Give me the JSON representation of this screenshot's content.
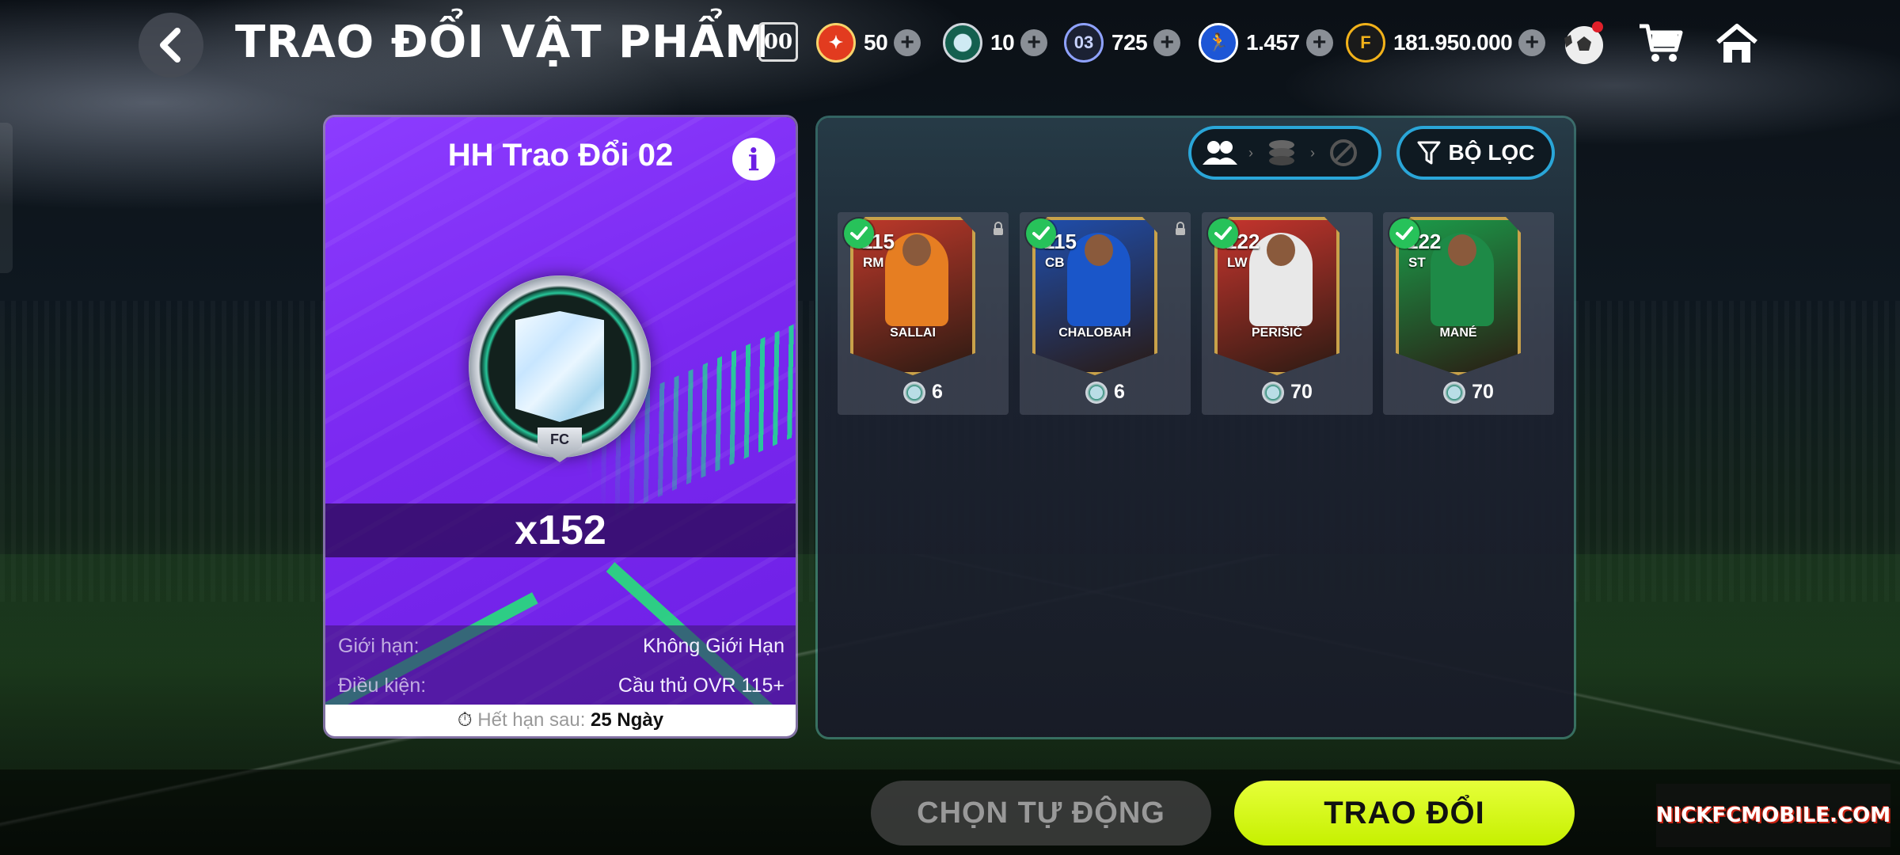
{
  "header": {
    "title": "TRAO ĐỔI VẬT PHẨM",
    "badge": "00",
    "currencies": [
      {
        "name": "orange-token",
        "value": "50",
        "color": "#e23b1f"
      },
      {
        "name": "shield-token",
        "value": "10",
        "color": "#2aa97f"
      },
      {
        "name": "card-token",
        "value": "725",
        "color": "#4f6bd1",
        "icon_text": "03"
      },
      {
        "name": "player-token",
        "value": "1.457",
        "color": "#2d6be0"
      },
      {
        "name": "fc-coins",
        "value": "181.950.000",
        "color": "#f2b21a"
      }
    ],
    "icons": [
      "football-icon",
      "cart-icon",
      "home-icon"
    ]
  },
  "left_panel": {
    "title": "HH Trao Đổi 02",
    "quantity": "x152",
    "medal_tag": "FC",
    "rows": [
      {
        "label": "Giới hạn:",
        "value": "Không Giới Hạn"
      },
      {
        "label": "Điều kiện:",
        "value": "Cầu thủ OVR 115+"
      }
    ],
    "expire_label": "Hết hạn sau:",
    "expire_value": "25 Ngày"
  },
  "right_panel": {
    "filter_label": "BỘ LỌC",
    "cards": [
      {
        "ovr": "115",
        "pos": "RM",
        "name": "SALLAI",
        "cost": "6",
        "locked": true,
        "theme": "#c0392b",
        "kit": "#e67e22"
      },
      {
        "ovr": "115",
        "pos": "CB",
        "name": "CHALOBAH",
        "cost": "6",
        "locked": true,
        "theme": "#1f4fb0",
        "kit": "#1a56c9"
      },
      {
        "ovr": "122",
        "pos": "LW",
        "name": "PERIŠIĆ",
        "cost": "70",
        "locked": false,
        "theme": "#c9352e",
        "kit": "#e8e8e8"
      },
      {
        "ovr": "122",
        "pos": "ST",
        "name": "MANÉ",
        "cost": "70",
        "locked": false,
        "theme": "#1b9e4b",
        "kit": "#1e8a47"
      }
    ]
  },
  "footer": {
    "auto_label": "CHỌN TỰ ĐỘNG",
    "trade_label": "TRAO ĐỔI",
    "watermark": "NICKFCMOBILE.COM"
  }
}
